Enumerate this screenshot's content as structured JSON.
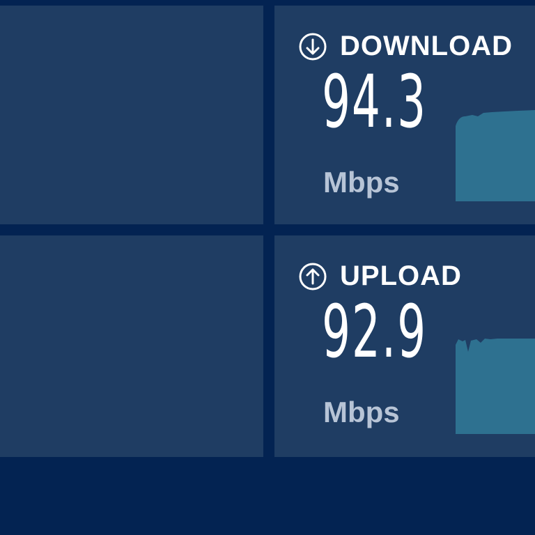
{
  "download": {
    "label": "DOWNLOAD",
    "value": "94.3",
    "unit": "Mbps",
    "icon": "arrow-down-circle-icon"
  },
  "upload": {
    "label": "UPLOAD",
    "value": "92.9",
    "unit": "Mbps",
    "icon": "arrow-up-circle-icon"
  },
  "colors": {
    "background": "#032352",
    "panel": "#1f3d63",
    "graph_fill": "#2e7190",
    "text": "#ffffff",
    "unit_text": "#b7c4d6"
  }
}
